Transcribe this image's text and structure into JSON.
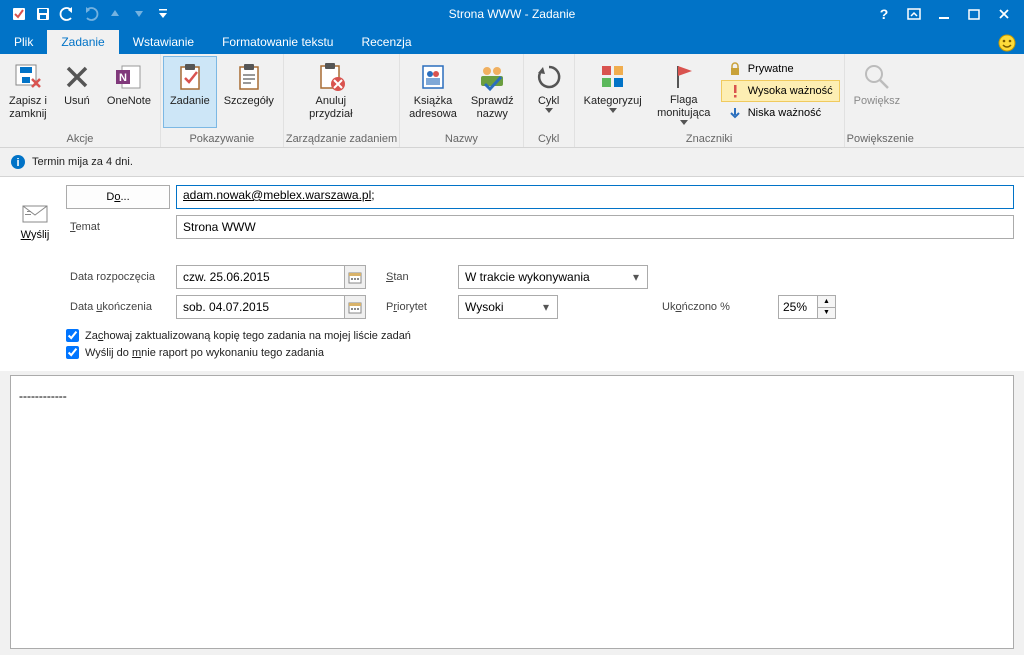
{
  "window": {
    "title": "Strona WWW - Zadanie"
  },
  "tabs": {
    "file": "Plik",
    "task": "Zadanie",
    "insert": "Wstawianie",
    "format": "Formatowanie tekstu",
    "review": "Recenzja"
  },
  "ribbon": {
    "groups": {
      "actions": "Akcje",
      "show": "Pokazywanie",
      "manage": "Zarządzanie zadaniem",
      "names": "Nazwy",
      "recurrence": "Cykl",
      "tags": "Znaczniki",
      "zoom": "Powiększenie"
    },
    "save_close": "Zapisz i\nzamknij",
    "delete": "Usuń",
    "onenote": "OneNote",
    "task": "Zadanie",
    "details": "Szczegóły",
    "cancel_assign": "Anuluj\nprzydział",
    "address_book": "Książka\nadresowa",
    "check_names": "Sprawdź\nnazwy",
    "recurrence_btn": "Cykl",
    "categorize": "Kategoryzuj",
    "flag": "Flaga\nmonitująca",
    "private": "Prywatne",
    "high_imp": "Wysoka ważność",
    "low_imp": "Niska ważność",
    "zoom_btn": "Powiększ"
  },
  "infobar": "Termin mija za 4 dni.",
  "form": {
    "send": "Wyślij",
    "to_label": "Do...",
    "to_value": "adam.nowak@meblex.warszawa.pl",
    "subject_label": "Temat",
    "subject_value": "Strona WWW",
    "start_label": "Data rozpoczęcia",
    "start_value": "czw. 25.06.2015",
    "due_label": "Data ukończenia",
    "due_value": "sob. 04.07.2015",
    "status_label": "Stan",
    "status_value": "W trakcie wykonywania",
    "priority_label": "Priorytet",
    "priority_value": "Wysoki",
    "complete_label": "Ukończono %",
    "complete_value": "25%",
    "check1": "Zachowaj zaktualizowaną kopię tego zadania na mojej liście zadań",
    "check2": "Wyślij do mnie raport po wykonaniu tego zadania"
  },
  "body": "------------"
}
